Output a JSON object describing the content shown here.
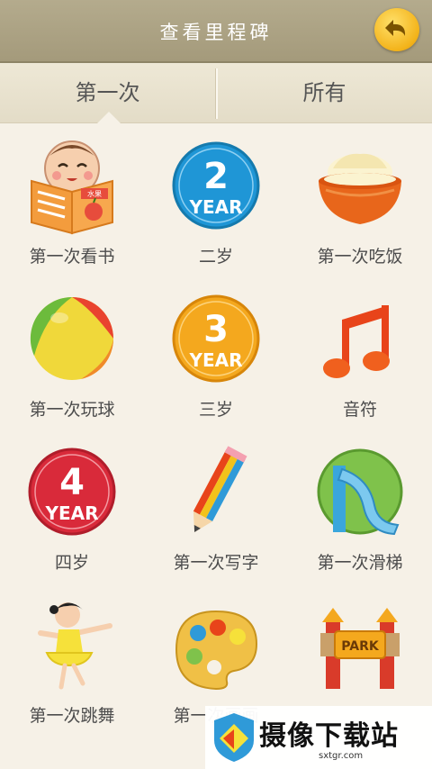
{
  "header": {
    "title": "查看里程碑",
    "back_icon": "back-arrow-icon"
  },
  "tabs": [
    {
      "label": "第一次",
      "active": true
    },
    {
      "label": "所有",
      "active": false
    }
  ],
  "milestones": [
    {
      "label": "第一次看书",
      "icon": "reading-baby-icon",
      "badge_text": "水果"
    },
    {
      "label": "二岁",
      "icon": "year-2-badge-icon",
      "badge_number": "2",
      "badge_word": "YEAR"
    },
    {
      "label": "第一次吃饭",
      "icon": "rice-bowl-icon"
    },
    {
      "label": "第一次玩球",
      "icon": "ball-icon"
    },
    {
      "label": "三岁",
      "icon": "year-3-badge-icon",
      "badge_number": "3",
      "badge_word": "YEAR"
    },
    {
      "label": "音符",
      "icon": "music-note-icon"
    },
    {
      "label": "四岁",
      "icon": "year-4-badge-icon",
      "badge_number": "4",
      "badge_word": "YEAR"
    },
    {
      "label": "第一次写字",
      "icon": "pencil-icon"
    },
    {
      "label": "第一次滑梯",
      "icon": "slide-icon"
    },
    {
      "label": "第一次跳舞",
      "icon": "dancing-girl-icon"
    },
    {
      "label": "第一次画画",
      "icon": "paint-palette-icon"
    },
    {
      "label": "",
      "icon": "park-gate-icon",
      "sign_text": "PARK"
    }
  ],
  "watermark": {
    "text": "摄像下载站",
    "url": "sxtgr.com"
  }
}
